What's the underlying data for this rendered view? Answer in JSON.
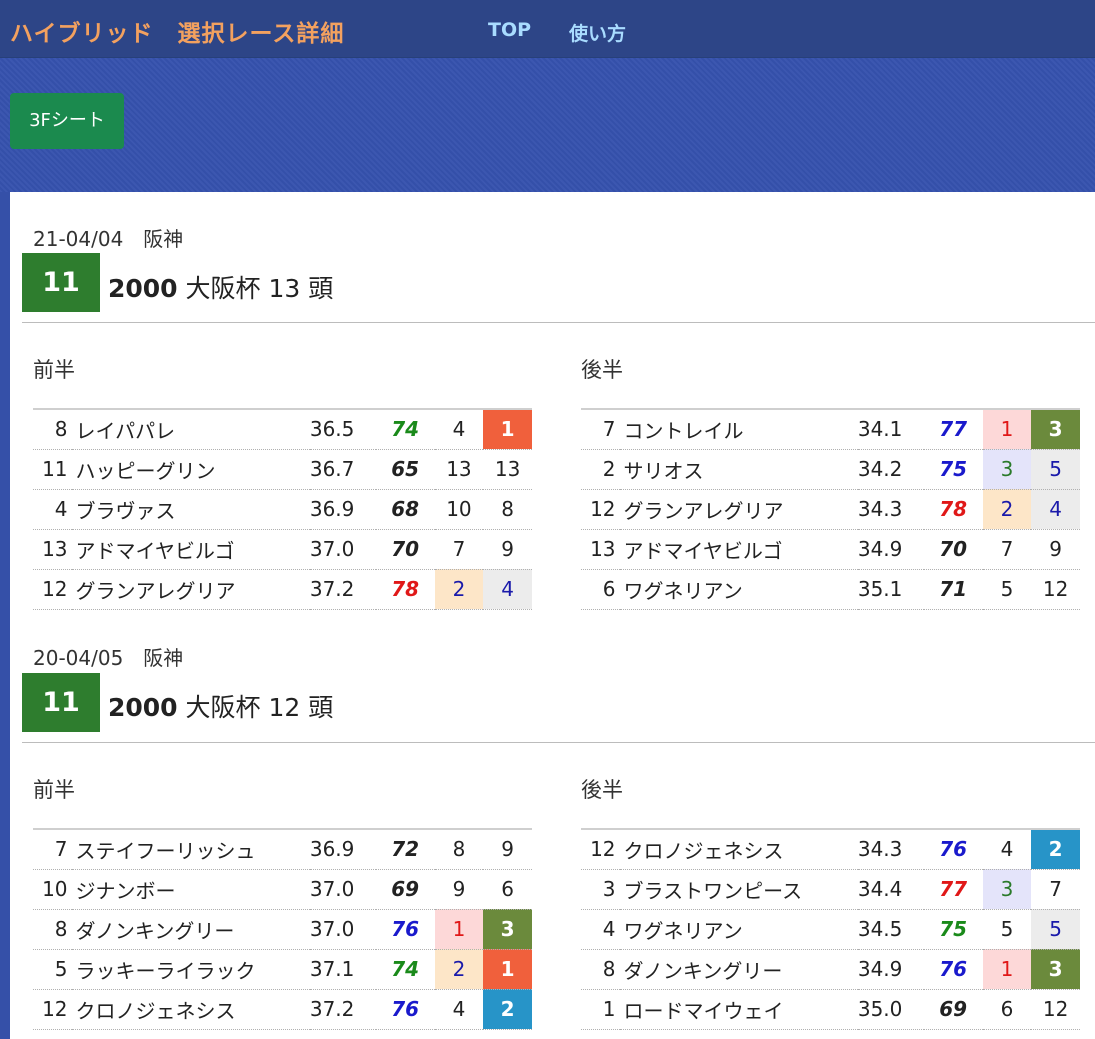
{
  "header": {
    "title": "ハイブリッド　選択レース詳細",
    "nav": [
      "TOP",
      "使い方"
    ]
  },
  "button_3f": "3Fシート",
  "colors": {
    "score_green": "#1a8a1a",
    "score_black": "#222222",
    "score_blue": "#1a1acc",
    "score_red": "#e01818",
    "rank_text_red": "#e01818",
    "rank_text_green": "#2a7a2a",
    "rank_text_blue": "#1a1aaa",
    "rank_bg_red": "#fdd8d8",
    "rank_bg_peach": "#fde6c8",
    "rank_bg_lav": "#e4e4fa",
    "rank_bg_grey": "#ececec",
    "badge1": "#f0603c",
    "badge2": "#2794c8",
    "badge3": "#6b8a3c"
  },
  "races": [
    {
      "date_venue": "21-04/04　阪神",
      "race_no": "11",
      "distance": "2000",
      "name_heads": " 大阪杯 13 頭",
      "front_label": "前半",
      "back_label": "後半",
      "front": [
        {
          "no": "8",
          "name": "レイパパレ",
          "time": "36.5",
          "score": "74",
          "sc": "green",
          "r1": "4",
          "r1s": "plain",
          "r2": "1",
          "r2s": "badge1"
        },
        {
          "no": "11",
          "name": "ハッピーグリン",
          "time": "36.7",
          "score": "65",
          "sc": "black",
          "r1": "13",
          "r1s": "plain",
          "r2": "13",
          "r2s": "plain"
        },
        {
          "no": "4",
          "name": "ブラヴァス",
          "time": "36.9",
          "score": "68",
          "sc": "black",
          "r1": "10",
          "r1s": "plain",
          "r2": "8",
          "r2s": "plain"
        },
        {
          "no": "13",
          "name": "アドマイヤビルゴ",
          "time": "37.0",
          "score": "70",
          "sc": "black",
          "r1": "7",
          "r1s": "plain",
          "r2": "9",
          "r2s": "plain"
        },
        {
          "no": "12",
          "name": "グランアレグリア",
          "time": "37.2",
          "score": "78",
          "sc": "red",
          "r1": "2",
          "r1s": "peach",
          "r2": "4",
          "r2s": "grey"
        }
      ],
      "back": [
        {
          "no": "7",
          "name": "コントレイル",
          "time": "34.1",
          "score": "77",
          "sc": "blue",
          "r1": "1",
          "r1s": "red",
          "r2": "3",
          "r2s": "badge3"
        },
        {
          "no": "2",
          "name": "サリオス",
          "time": "34.2",
          "score": "75",
          "sc": "blue",
          "r1": "3",
          "r1s": "lav",
          "r2": "5",
          "r2s": "grey"
        },
        {
          "no": "12",
          "name": "グランアレグリア",
          "time": "34.3",
          "score": "78",
          "sc": "red",
          "r1": "2",
          "r1s": "peach",
          "r2": "4",
          "r2s": "grey"
        },
        {
          "no": "13",
          "name": "アドマイヤビルゴ",
          "time": "34.9",
          "score": "70",
          "sc": "black",
          "r1": "7",
          "r1s": "plain",
          "r2": "9",
          "r2s": "plain"
        },
        {
          "no": "6",
          "name": "ワグネリアン",
          "time": "35.1",
          "score": "71",
          "sc": "black",
          "r1": "5",
          "r1s": "plain",
          "r2": "12",
          "r2s": "plain"
        }
      ]
    },
    {
      "date_venue": "20-04/05　阪神",
      "race_no": "11",
      "distance": "2000",
      "name_heads": " 大阪杯 12 頭",
      "front_label": "前半",
      "back_label": "後半",
      "front": [
        {
          "no": "7",
          "name": "ステイフーリッシュ",
          "time": "36.9",
          "score": "72",
          "sc": "black",
          "r1": "8",
          "r1s": "plain",
          "r2": "9",
          "r2s": "plain"
        },
        {
          "no": "10",
          "name": "ジナンボー",
          "time": "37.0",
          "score": "69",
          "sc": "black",
          "r1": "9",
          "r1s": "plain",
          "r2": "6",
          "r2s": "plain"
        },
        {
          "no": "8",
          "name": "ダノンキングリー",
          "time": "37.0",
          "score": "76",
          "sc": "blue",
          "r1": "1",
          "r1s": "red",
          "r2": "3",
          "r2s": "badge3"
        },
        {
          "no": "5",
          "name": "ラッキーライラック",
          "time": "37.1",
          "score": "74",
          "sc": "green",
          "r1": "2",
          "r1s": "peach",
          "r2": "1",
          "r2s": "badge1"
        },
        {
          "no": "12",
          "name": "クロノジェネシス",
          "time": "37.2",
          "score": "76",
          "sc": "blue",
          "r1": "4",
          "r1s": "plain",
          "r2": "2",
          "r2s": "badge2"
        }
      ],
      "back": [
        {
          "no": "12",
          "name": "クロノジェネシス",
          "time": "34.3",
          "score": "76",
          "sc": "blue",
          "r1": "4",
          "r1s": "plain",
          "r2": "2",
          "r2s": "badge2"
        },
        {
          "no": "3",
          "name": "ブラストワンピース",
          "time": "34.4",
          "score": "77",
          "sc": "red",
          "r1": "3",
          "r1s": "lav",
          "r2": "7",
          "r2s": "plain"
        },
        {
          "no": "4",
          "name": "ワグネリアン",
          "time": "34.5",
          "score": "75",
          "sc": "green",
          "r1": "5",
          "r1s": "plain",
          "r2": "5",
          "r2s": "grey"
        },
        {
          "no": "8",
          "name": "ダノンキングリー",
          "time": "34.9",
          "score": "76",
          "sc": "blue",
          "r1": "1",
          "r1s": "red",
          "r2": "3",
          "r2s": "badge3"
        },
        {
          "no": "1",
          "name": "ロードマイウェイ",
          "time": "35.0",
          "score": "69",
          "sc": "black",
          "r1": "6",
          "r1s": "plain",
          "r2": "12",
          "r2s": "plain"
        }
      ]
    }
  ]
}
